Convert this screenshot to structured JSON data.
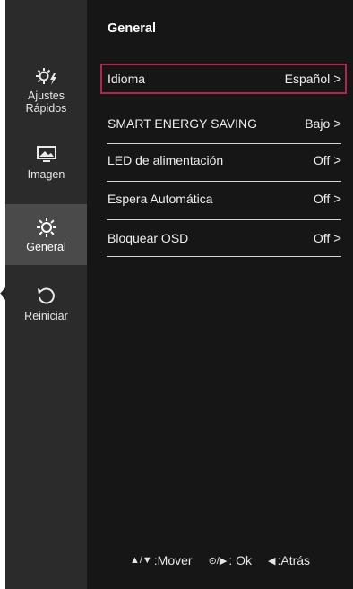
{
  "sidebar": {
    "items": [
      {
        "label_line1": "Ajustes",
        "label_line2": "Rápidos",
        "icon": "quick-settings-icon"
      },
      {
        "label": "Imagen",
        "icon": "picture-icon"
      },
      {
        "label": "General",
        "icon": "gear-icon",
        "active": true
      },
      {
        "label": "Reiniciar",
        "icon": "reset-icon"
      }
    ]
  },
  "main": {
    "title": "General",
    "rows": [
      {
        "label": "Idioma",
        "value": "Español"
      },
      {
        "label": "SMART ENERGY SAVING",
        "value": "Bajo"
      },
      {
        "label": "LED de alimentación",
        "value": "Off"
      },
      {
        "label": "Espera Automática",
        "value": "Off"
      },
      {
        "label": "Bloquear OSD",
        "value": "Off"
      }
    ]
  },
  "footer": {
    "move_symbol": "▲/▼",
    "move_label": ":Mover",
    "ok_symbol": "⊙/▶",
    "ok_label": ": Ok",
    "back_symbol": "◀",
    "back_label": ":Atrás"
  },
  "colors": {
    "highlight": "#b0264d",
    "sidebar_bg": "#2b2b2b",
    "main_bg": "#161616"
  }
}
